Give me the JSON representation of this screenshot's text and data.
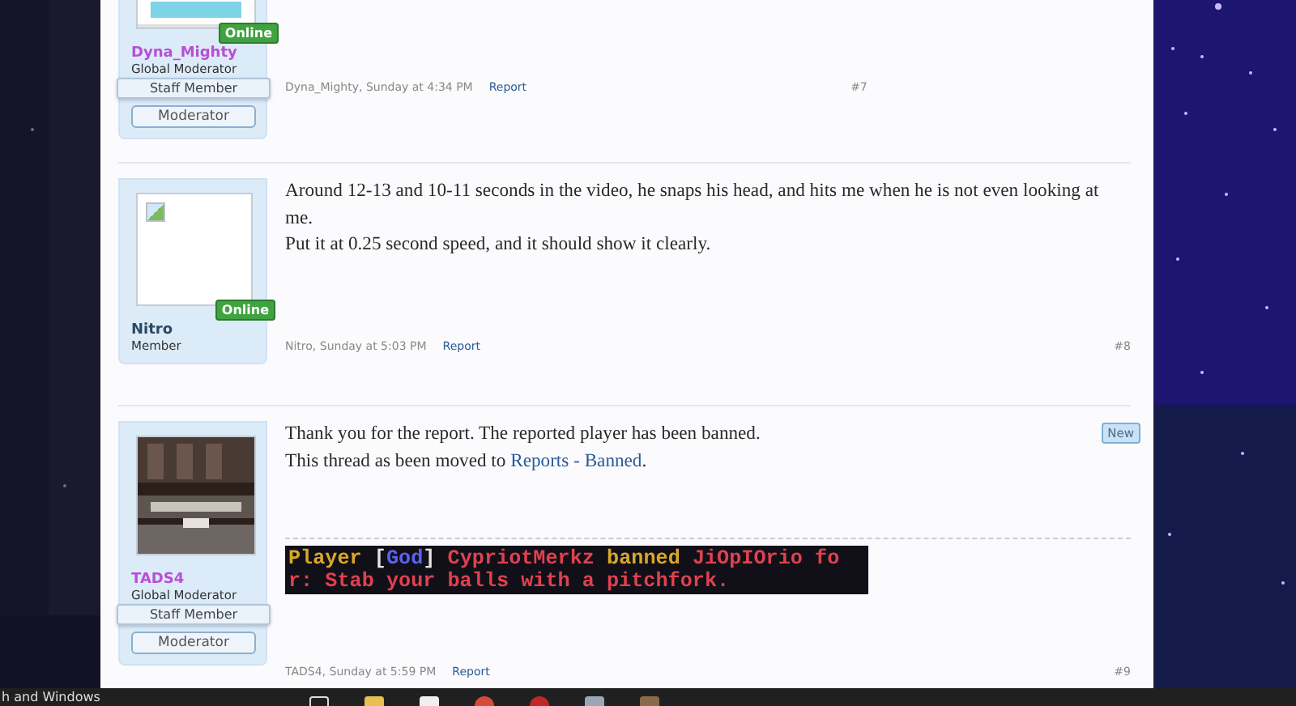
{
  "posts": [
    {
      "avatar": {
        "kind": "picture"
      },
      "online": true,
      "online_label": "Online",
      "username": "Dyna_Mighty",
      "color": "#b84fd6",
      "user_title": "Global Moderator",
      "staff_ribbon": "Staff Member",
      "banner": "Moderator",
      "is_new": false,
      "meta": {
        "author_time": "Dyna_Mighty, Sunday at 4:34 PM",
        "report": "Report",
        "number": "#7"
      }
    },
    {
      "avatar": {
        "kind": "broken"
      },
      "online": true,
      "online_label": "Online",
      "username": "Nitro",
      "color": "#2b4a63",
      "user_title": "Member",
      "is_new": false,
      "message": [
        [
          {
            "text": "Around 12-13 and 10-11 seconds in the video, he snaps his head, and hits me when he is not even looking at me."
          }
        ],
        [
          {
            "text": "Put it at 0.25 second speed, and it should show it clearly."
          }
        ]
      ],
      "meta": {
        "author_time": "Nitro, Sunday at 5:03 PM",
        "report": "Report",
        "number": "#8"
      }
    },
    {
      "avatar": {
        "kind": "picture"
      },
      "online": false,
      "username": "TADS4",
      "color": "#b84fd6",
      "user_title": "Global Moderator",
      "staff_ribbon": "Staff Member",
      "banner": "Moderator",
      "is_new": true,
      "new_label": "New",
      "message": [
        [
          {
            "text": "Thank you for the report. The reported player has been banned."
          }
        ],
        [
          {
            "text": "This thread as been moved to "
          },
          {
            "link": "Reports - Banned"
          },
          {
            "text": "."
          }
        ]
      ],
      "game_chat": [
        [
          {
            "text": "Player ",
            "color": "#d9a82a"
          },
          {
            "text": "[",
            "color": "#e6e6e6"
          },
          {
            "text": "God",
            "color": "#5a63f0"
          },
          {
            "text": "] ",
            "color": "#e6e6e6"
          },
          {
            "text": "CypriotMerkz ",
            "color": "#e0414f"
          },
          {
            "text": "banned ",
            "color": "#d9a82a"
          },
          {
            "text": "JiOpIOrio fo",
            "color": "#e0414f"
          }
        ],
        [
          {
            "text": "r: Stab your balls with a pitchfork.",
            "color": "#e0414f"
          }
        ]
      ],
      "meta": {
        "author_time": "TADS4, Sunday at 5:59 PM",
        "report": "Report",
        "number": "#9"
      }
    }
  ],
  "taskbar": {
    "search_text": "h and Windows"
  }
}
